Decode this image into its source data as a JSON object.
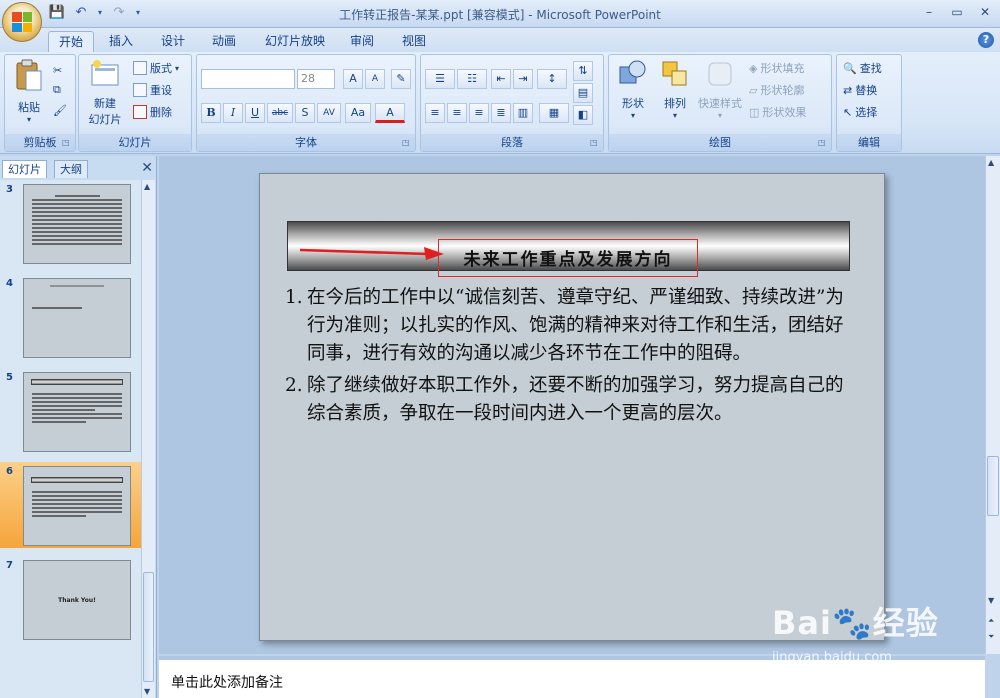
{
  "window": {
    "title": "工作转正报告-某某.ppt [兼容模式] - Microsoft PowerPoint",
    "controls": [
      "–",
      "▭",
      "✕"
    ]
  },
  "tabs": [
    "开始",
    "插入",
    "设计",
    "动画",
    "幻灯片放映",
    "审阅",
    "视图"
  ],
  "ribbon": {
    "clipboard": {
      "label": "剪贴板",
      "paste": "粘贴"
    },
    "slides": {
      "label": "幻灯片",
      "new_slide_1": "新建",
      "new_slide_2": "幻灯片",
      "layout": "版式",
      "reset": "重设",
      "delete": "删除"
    },
    "font": {
      "label": "字体",
      "font_name": "",
      "font_size": "28",
      "bold": "B",
      "italic": "I",
      "underline": "U",
      "strike": "abc",
      "shadow": "S",
      "spacing": "AV",
      "case": "Aa",
      "color": "A",
      "grow": "A",
      "shrink": "A"
    },
    "paragraph": {
      "label": "段落"
    },
    "drawing": {
      "label": "绘图",
      "shapes": "形状",
      "arrange": "排列",
      "quick_styles": "快速样式",
      "fill": "形状填充",
      "outline": "形状轮廓",
      "effects": "形状效果"
    },
    "editing": {
      "label": "编辑",
      "find": "查找",
      "replace": "替换",
      "select": "选择"
    }
  },
  "left_panel": {
    "tabs": [
      "幻灯片",
      "大纲"
    ],
    "close": "✕",
    "thumbnails": [
      {
        "num": "3"
      },
      {
        "num": "4"
      },
      {
        "num": "5"
      },
      {
        "num": "6"
      },
      {
        "num": "7",
        "text": "Thank You!"
      }
    ]
  },
  "slide": {
    "heading": "未来工作重点及发展方向",
    "items": [
      {
        "num": "1.",
        "text": "在今后的工作中以“诚信刻苦、遵章守纪、严谨细致、持续改进”为行为准则；以扎实的作风、饱满的精神来对待工作和生活，团结好同事，进行有效的沟通以减少各环节在工作中的阻碍。"
      },
      {
        "num": "2.",
        "text": "除了继续做好本职工作外，还要不断的加强学习，努力提高自己的综合素质，争取在一段时间内进入一个更高的层次。"
      }
    ]
  },
  "notes": {
    "placeholder": "单击此处添加备注"
  },
  "watermark": {
    "logo": "Bai🐾经验",
    "url": "jingyan.baidu.com"
  }
}
